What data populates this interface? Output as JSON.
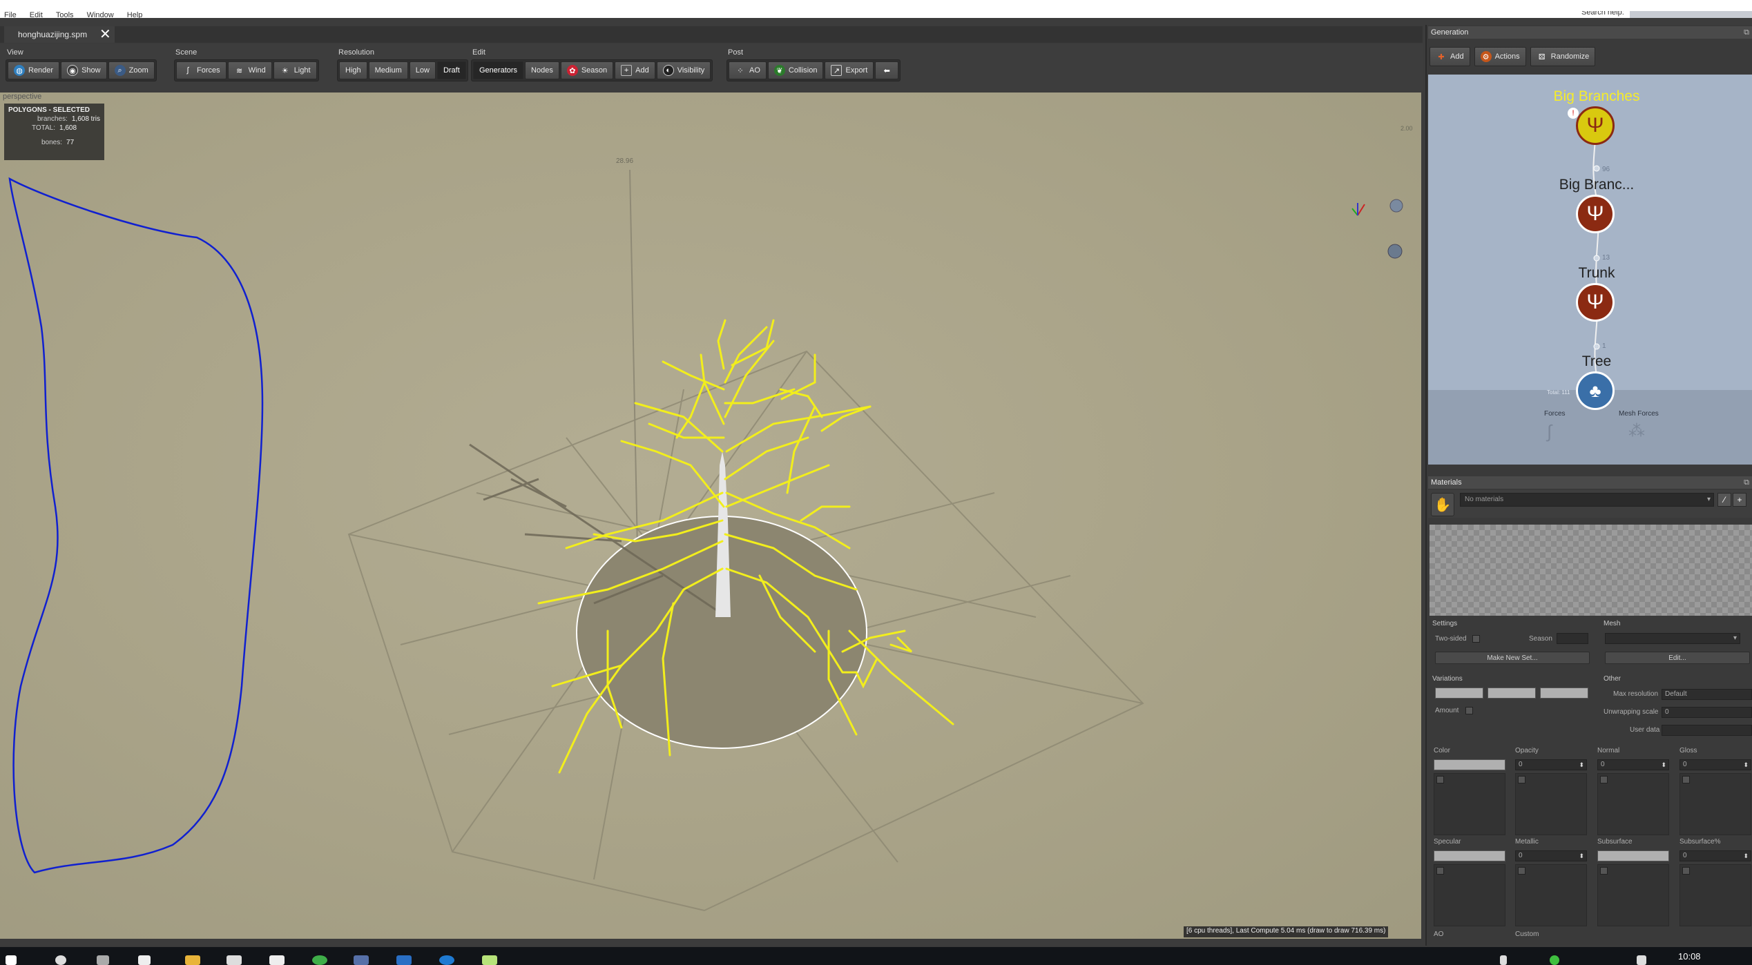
{
  "menu": [
    "File",
    "Edit",
    "Tools",
    "Window",
    "Help"
  ],
  "search": {
    "label": "Search help:"
  },
  "document_tab": {
    "title": "honghuazijing.spm",
    "close_glyph": "✕"
  },
  "toolbar": {
    "groups": [
      {
        "label": "View",
        "buttons": [
          {
            "label": "Render",
            "icon": "render-icon"
          },
          {
            "label": "Show",
            "icon": "show-icon"
          },
          {
            "label": "Zoom",
            "icon": "zoom-icon"
          }
        ]
      },
      {
        "label": "Scene",
        "buttons": [
          {
            "label": "Forces",
            "icon": "forces-icon"
          },
          {
            "label": "Wind",
            "icon": "wind-icon"
          },
          {
            "label": "Light",
            "icon": "light-icon"
          }
        ]
      },
      {
        "label": "Resolution",
        "buttons": [
          {
            "label": "High"
          },
          {
            "label": "Medium"
          },
          {
            "label": "Low"
          },
          {
            "label": "Draft",
            "active": true
          }
        ]
      },
      {
        "label": "Edit",
        "buttons": [
          {
            "label": "Generators",
            "active": true
          },
          {
            "label": "Nodes"
          },
          {
            "label": "Season",
            "icon": "season-icon"
          },
          {
            "label": "Add",
            "icon": "add-icon"
          },
          {
            "label": "Visibility",
            "icon": "visibility-icon"
          }
        ]
      },
      {
        "label": "Post",
        "buttons": [
          {
            "label": "AO",
            "icon": "ao-icon"
          },
          {
            "label": "Collision",
            "icon": "collision-icon"
          },
          {
            "label": "Export",
            "icon": "export-icon"
          },
          {
            "label": "",
            "icon": "back-arrow-icon"
          }
        ]
      }
    ]
  },
  "viewport": {
    "camera_label": "perspective",
    "stats": {
      "header": "POLYGONS - SELECTED",
      "branches_label": "branches:",
      "branches_value": "1,608 tris",
      "total_label": "TOTAL:",
      "total_value": "1,608",
      "bones_label": "bones:",
      "bones_value": "77"
    },
    "height_marker": "28.96",
    "zoom_value": "2.00",
    "status": "[6 cpu threads], Last Compute 5.04 ms (draw to draw 716.39 ms)"
  },
  "generation": {
    "title": "Generation",
    "buttons": [
      {
        "label": "Add"
      },
      {
        "label": "Actions"
      },
      {
        "label": "Randomize"
      }
    ],
    "nodes": [
      {
        "label": "Big Branches",
        "count": "96",
        "selected": true
      },
      {
        "label": "Big Branc...",
        "count": "13"
      },
      {
        "label": "Trunk",
        "count": "1"
      },
      {
        "label": "Tree",
        "count": "Total: 111"
      }
    ],
    "lower_labels": [
      "Forces",
      "Mesh Forces"
    ]
  },
  "materials": {
    "title": "Materials",
    "selected": "No materials",
    "settings": {
      "section": "Settings",
      "two_sided": "Two-sided",
      "season": "Season",
      "make_new_set": "Make New Set..."
    },
    "mesh": {
      "section": "Mesh",
      "edit": "Edit..."
    },
    "variations": {
      "section": "Variations",
      "amount": "Amount"
    },
    "other": {
      "section": "Other",
      "max_resolution_label": "Max resolution",
      "max_resolution_value": "Default",
      "unwrapping_label": "Unwrapping scale",
      "unwrapping_value": "0",
      "user_data": "User data"
    },
    "maps_row1": [
      {
        "label": "Color"
      },
      {
        "label": "Opacity",
        "value": "0"
      },
      {
        "label": "Normal",
        "value": "0"
      },
      {
        "label": "Gloss",
        "value": "0"
      }
    ],
    "maps_row2": [
      {
        "label": "Specular"
      },
      {
        "label": "Metallic",
        "value": "0"
      },
      {
        "label": "Subsurface"
      },
      {
        "label": "Subsurface%",
        "value": "0"
      }
    ],
    "maps_row3": [
      "AO",
      "Custom"
    ]
  },
  "taskbar": {
    "time": "10:08"
  }
}
